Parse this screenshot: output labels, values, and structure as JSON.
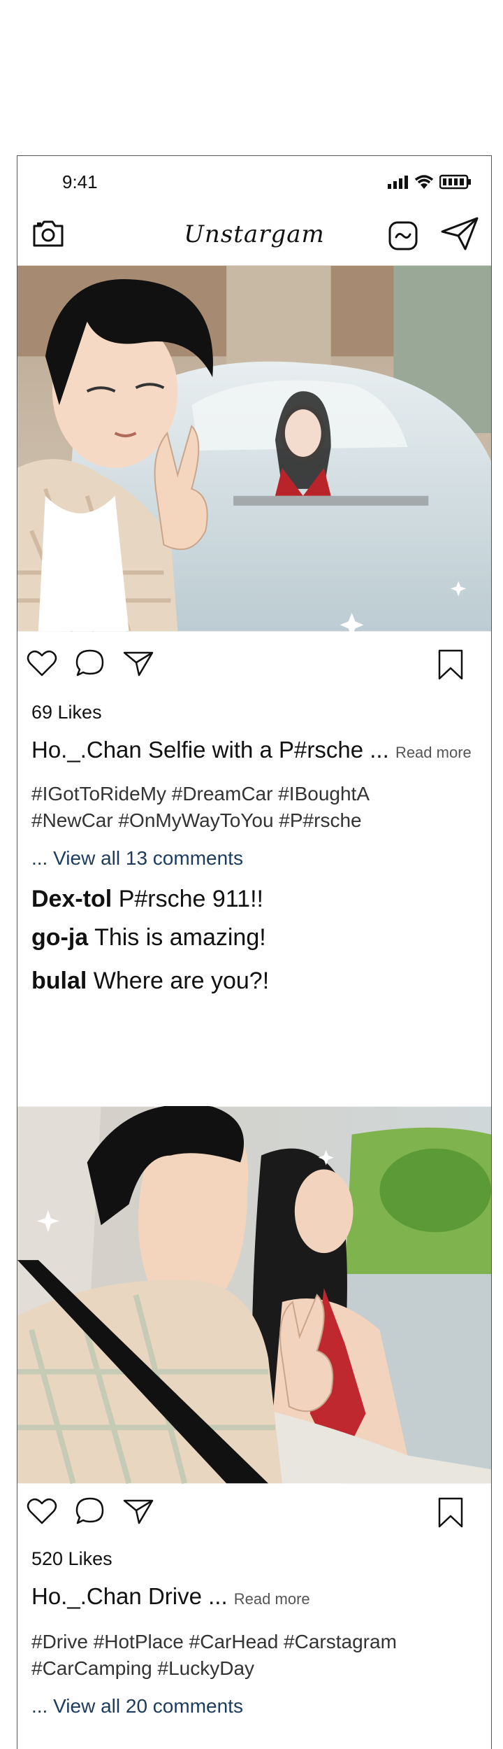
{
  "status_bar": {
    "time": "9:41"
  },
  "app": {
    "title": "Unstargam"
  },
  "posts": [
    {
      "likes": "69 Likes",
      "user": "Ho._.Chan",
      "caption": "Selfie with a P#rsche ...",
      "read_more": "Read more",
      "tags_line1": "#IGotToRideMy #DreamCar #IBoughtA",
      "tags_line2": "#NewCar #OnMyWayToYou #P#rsche",
      "view_all": "... View all 13 comments",
      "comments": [
        {
          "user": "Dex-tol",
          "text": "P#rsche 911!!"
        },
        {
          "user": "go-ja",
          "text": "This is amazing!"
        },
        {
          "user": "bulal",
          "text": "Where are you?!"
        }
      ]
    },
    {
      "likes": "520 Likes",
      "user": "Ho._.Chan",
      "caption": "Drive ...",
      "read_more": "Read more",
      "tags_line1": "#Drive #HotPlace #CarHead #Carstagram",
      "tags_line2": "#CarCamping #LuckyDay",
      "view_all": "... View all 20 comments"
    }
  ]
}
